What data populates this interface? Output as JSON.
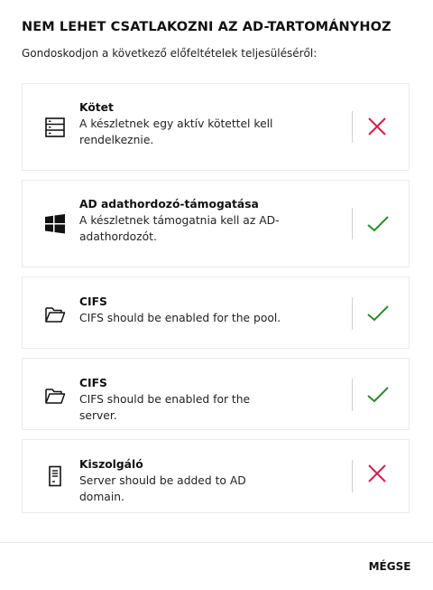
{
  "dialog": {
    "title": "NEM LEHET CSATLAKOZNI AZ AD-TARTOMÁNYHOZ",
    "subtitle": "Gondoskodjon a következő előfeltételek teljesüléséről:"
  },
  "prerequisites": [
    {
      "icon": "volume-icon",
      "name": "Kötet",
      "description": "A készletnek egy aktív kötettel kell rendelkeznie.",
      "status": "fail"
    },
    {
      "icon": "windows-icon",
      "name": "AD adathordozó-támogatása",
      "description": "A készletnek támogatnia kell az AD-adathordozót.",
      "status": "pass"
    },
    {
      "icon": "folder-icon",
      "name": "CIFS",
      "description": "CIFS should be enabled for the pool.",
      "status": "pass"
    },
    {
      "icon": "folder-icon",
      "name": "CIFS",
      "description": "CIFS should be enabled for the server.",
      "status": "pass"
    },
    {
      "icon": "server-icon",
      "name": "Kiszolgáló",
      "description": "Server should be added to AD domain.",
      "status": "fail"
    }
  ],
  "footer": {
    "cancel_label": "MÉGSE"
  },
  "colors": {
    "pass": "#2e8b2e",
    "fail": "#d4204f"
  }
}
